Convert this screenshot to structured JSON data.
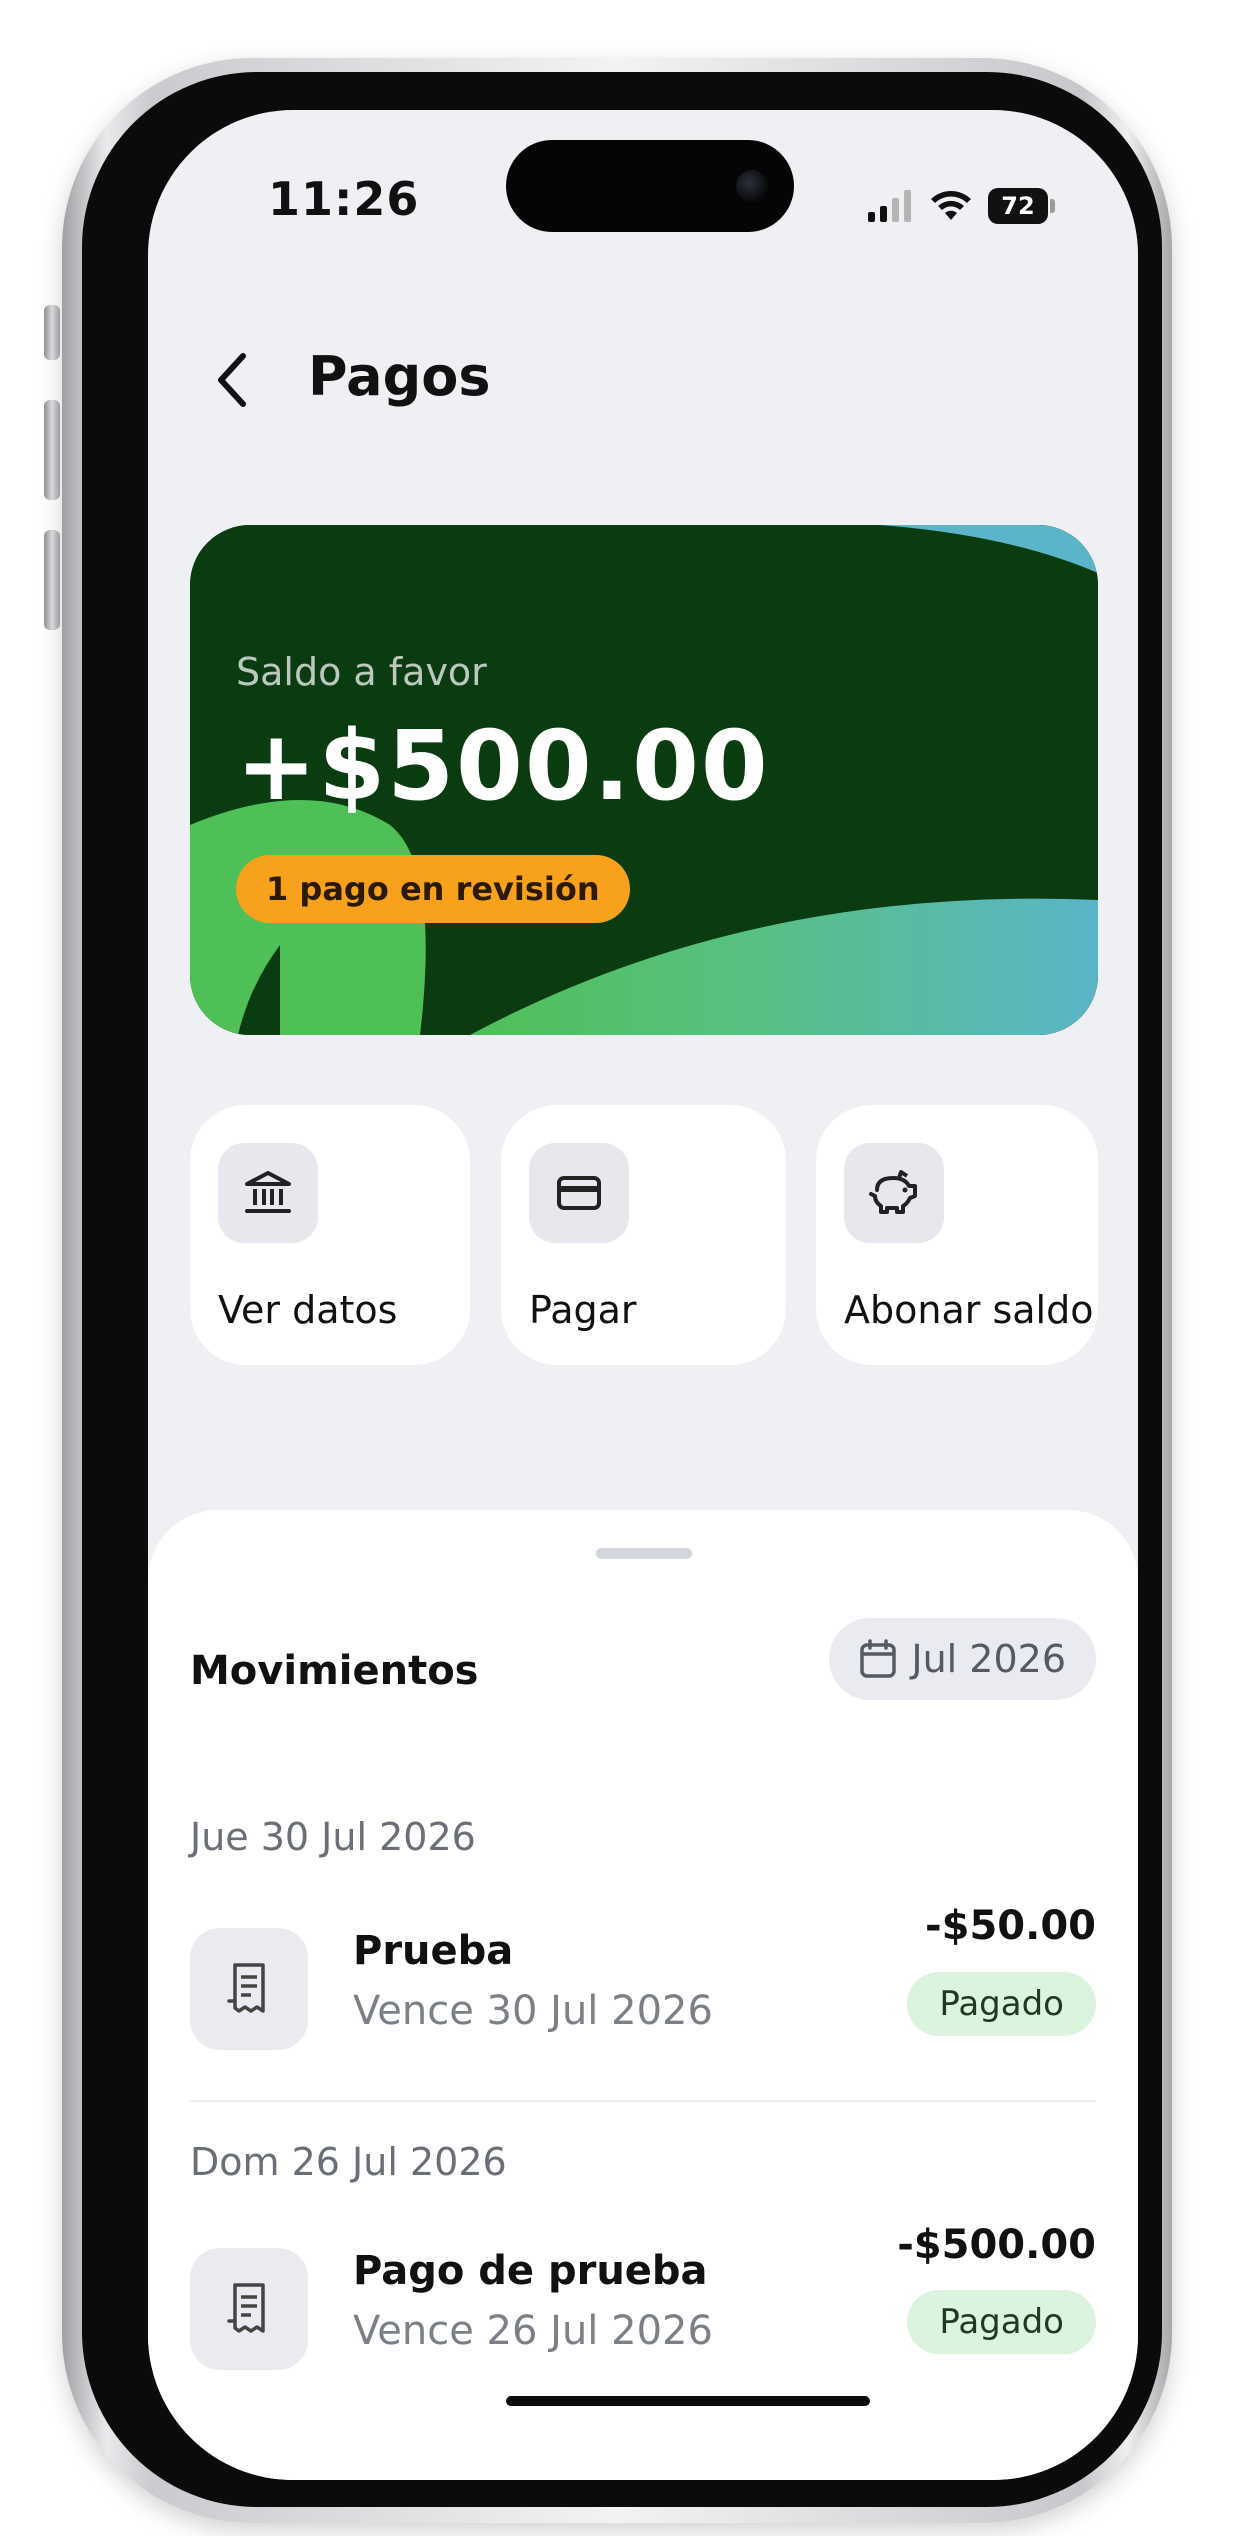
{
  "status_bar": {
    "time": "11:26",
    "battery": "72"
  },
  "header": {
    "title": "Pagos"
  },
  "balance_card": {
    "label": "Saldo a favor",
    "amount": "+$500.00",
    "badge": "1 pago en revisión",
    "colors": {
      "background": "#0b3b10",
      "badge": "#f7a11c",
      "wave_green": "#4fbf57",
      "wave_blue": "#5ab5c8"
    }
  },
  "actions": [
    {
      "label": "Ver datos",
      "icon": "bank-icon"
    },
    {
      "label": "Pagar",
      "icon": "credit-card-icon"
    },
    {
      "label": "Abonar saldo",
      "icon": "piggy-bank-icon"
    }
  ],
  "movements": {
    "title": "Movimientos",
    "filter": {
      "label": "Jul 2026",
      "icon": "calendar-icon"
    },
    "groups": [
      {
        "date": "Jue 30 Jul 2026",
        "items": [
          {
            "name": "Prueba",
            "due": "Vence 30 Jul 2026",
            "amount": "-$50.00",
            "status": "Pagado",
            "icon": "receipt-icon"
          }
        ]
      },
      {
        "date": "Dom 26 Jul 2026",
        "items": [
          {
            "name": "Pago de prueba",
            "due": "Vence 26 Jul 2026",
            "amount": "-$500.00",
            "status": "Pagado",
            "icon": "receipt-icon"
          }
        ]
      }
    ]
  },
  "colors": {
    "status_paid_bg": "#dcf3de",
    "screen_bg": "#eef0f4"
  }
}
